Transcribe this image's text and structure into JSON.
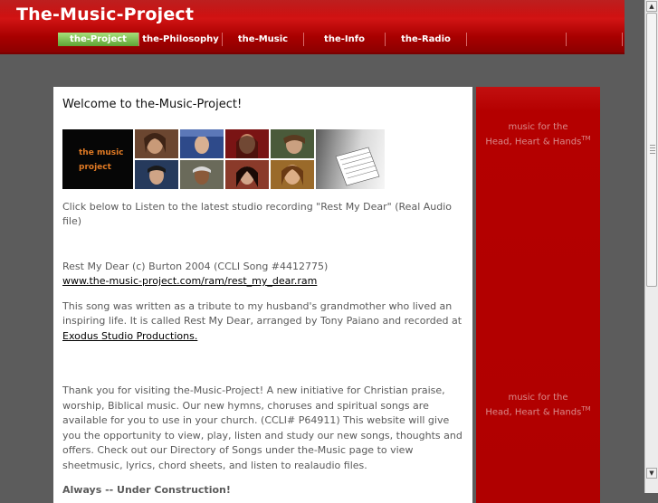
{
  "header": {
    "title": "The-Music-Project",
    "nav": [
      {
        "label": "the-Project",
        "active": true
      },
      {
        "label": "the-Philosophy",
        "active": false
      },
      {
        "label": "the-Music",
        "active": false
      },
      {
        "label": "the-Info",
        "active": false
      },
      {
        "label": "the-Radio",
        "active": false
      },
      {
        "label": "",
        "active": false
      },
      {
        "label": "",
        "active": false
      }
    ]
  },
  "main": {
    "heading": "Welcome to the-Music-Project!",
    "banner_logo_text": "the music project",
    "listen_intro": "Click below to Listen to the latest studio recording \"Rest My Dear\" (Real Audio file)",
    "song_credit": "Rest My Dear (c) Burton 2004 (CCLI Song #4412775)",
    "song_link": "www.the-music-project.com/ram/rest_my_dear.ram",
    "tribute_text": "This song was written as a tribute to my husband's grandmother who lived an inspiring life. It is called Rest My Dear, arranged by Tony Paiano and recorded at",
    "studio_link": "Exodus Studio Productions.",
    "thanks_text": "Thank you for visiting the-Music-Project! A new initiative for Christian praise, worship, Biblical music. Our new hymns, choruses and spiritual songs are available for you to use in your church. (CCLI# P64911) This website will give you the opportunity to view, play, listen and study our new songs, thoughts and offers. Check out our Directory of Songs under the-Music page to view sheetmusic, lyrics, chord sheets, and listen to realaudio files.",
    "construction": "Always -- Under Construction!"
  },
  "sidebar": {
    "tagline_line1": "music for the",
    "tagline_line2": "Head, Heart & Hands",
    "trademark": "TM"
  },
  "colors": {
    "brand_red": "#b40000",
    "active_tab_green": "#6fb33f",
    "page_bg": "#5c5c5c"
  }
}
